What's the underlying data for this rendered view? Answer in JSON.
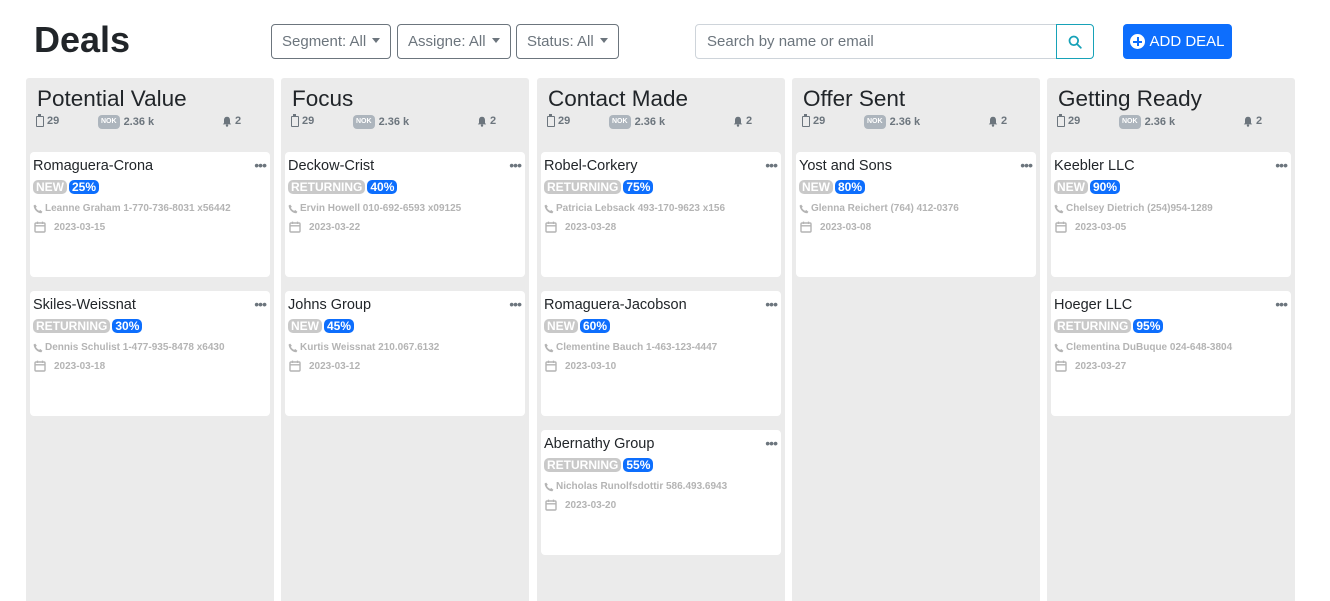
{
  "header": {
    "title": "Deals",
    "filters": [
      {
        "label": "Segment: All"
      },
      {
        "label": "Assigne: All"
      },
      {
        "label": "Status: All"
      }
    ],
    "search": {
      "placeholder": "Search by name or email",
      "value": ""
    },
    "add_button_label": "ADD DEAL"
  },
  "colors": {
    "primary": "#0d6efd",
    "info": "#17a2b8",
    "column_bg": "#ebebeb",
    "status_badge": "#c9c9c9",
    "muted_text": "#b4b4b4"
  },
  "icons": {
    "count": "clipboard-icon",
    "currency": "nok-currency-icon",
    "alerts": "bell-icon",
    "phone": "phone-icon",
    "date": "calendar-icon",
    "menu": "ellipsis-icon",
    "search": "search-icon",
    "add": "plus-circle-icon"
  },
  "columns": [
    {
      "title": "Potential Value",
      "count": "29",
      "currency": "NOK",
      "value": "2.36 k",
      "alerts": "2",
      "cards": [
        {
          "name": "Romaguera-Crona",
          "status": "NEW",
          "probability": "25%",
          "contact": "Leanne Graham 1-770-736-8031 x56442",
          "date": "2023-03-15"
        },
        {
          "name": "Skiles-Weissnat",
          "status": "RETURNING",
          "probability": "30%",
          "contact": "Dennis Schulist 1-477-935-8478 x6430",
          "date": "2023-03-18"
        }
      ]
    },
    {
      "title": "Focus",
      "count": "29",
      "currency": "NOK",
      "value": "2.36 k",
      "alerts": "2",
      "cards": [
        {
          "name": "Deckow-Crist",
          "status": "RETURNING",
          "probability": "40%",
          "contact": "Ervin Howell 010-692-6593 x09125",
          "date": "2023-03-22"
        },
        {
          "name": "Johns Group",
          "status": "NEW",
          "probability": "45%",
          "contact": "Kurtis Weissnat 210.067.6132",
          "date": "2023-03-12"
        }
      ]
    },
    {
      "title": "Contact Made",
      "count": "29",
      "currency": "NOK",
      "value": "2.36 k",
      "alerts": "2",
      "cards": [
        {
          "name": "Robel-Corkery",
          "status": "RETURNING",
          "probability": "75%",
          "contact": "Patricia Lebsack 493-170-9623 x156",
          "date": "2023-03-28"
        },
        {
          "name": "Romaguera-Jacobson",
          "status": "NEW",
          "probability": "60%",
          "contact": "Clementine Bauch 1-463-123-4447",
          "date": "2023-03-10"
        },
        {
          "name": "Abernathy Group",
          "status": "RETURNING",
          "probability": "55%",
          "contact": "Nicholas Runolfsdottir 586.493.6943",
          "date": "2023-03-20"
        }
      ]
    },
    {
      "title": "Offer Sent",
      "count": "29",
      "currency": "NOK",
      "value": "2.36 k",
      "alerts": "2",
      "cards": [
        {
          "name": "Yost and Sons",
          "status": "NEW",
          "probability": "80%",
          "contact": "Glenna Reichert (764) 412-0376",
          "date": "2023-03-08"
        }
      ]
    },
    {
      "title": "Getting Ready",
      "count": "29",
      "currency": "NOK",
      "value": "2.36 k",
      "alerts": "2",
      "cards": [
        {
          "name": "Keebler LLC",
          "status": "NEW",
          "probability": "90%",
          "contact": "Chelsey Dietrich (254)954-1289",
          "date": "2023-03-05"
        },
        {
          "name": "Hoeger LLC",
          "status": "RETURNING",
          "probability": "95%",
          "contact": "Clementina DuBuque 024-648-3804",
          "date": "2023-03-27"
        }
      ]
    }
  ]
}
